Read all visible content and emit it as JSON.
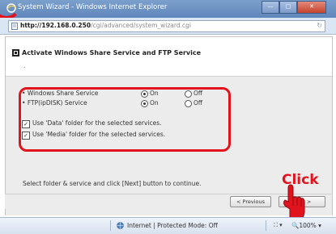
{
  "window": {
    "title": "System Wizard - Windows Internet Explorer"
  },
  "address_bar": {
    "url_host": "http://192.168.0.250",
    "url_path": "/cgi/advanced/system_wizard.cgi"
  },
  "page": {
    "title": "Activate Windows Share Service and FTP Service",
    "subtitle_dot": "."
  },
  "services": [
    {
      "label": "Windows Share Service",
      "on_label": "On",
      "off_label": "Off",
      "selected": "On"
    },
    {
      "label": "FTP(ipDISK) Service",
      "on_label": "On",
      "off_label": "Off",
      "selected": "On"
    }
  ],
  "folders": [
    {
      "label": "Use 'Data' folder for the selected services.",
      "checked": true
    },
    {
      "label": "Use 'Media' folder for the selected services.",
      "checked": true
    }
  ],
  "instruction": "Select folder & service and click [Next] button to continue.",
  "buttons": {
    "previous": "< Previous",
    "next": "Next >"
  },
  "annotation": {
    "click_label": "Click"
  },
  "status_bar": {
    "zone": "Internet | Protected Mode: Off",
    "zoom": "100%",
    "zoom_icon": "zoom-icon",
    "tools": "⛶ ▾"
  },
  "colors": {
    "annotation_red": "#e1141e",
    "titlebar_blue": "#6a8fc2",
    "panel_gray": "#ececec"
  }
}
